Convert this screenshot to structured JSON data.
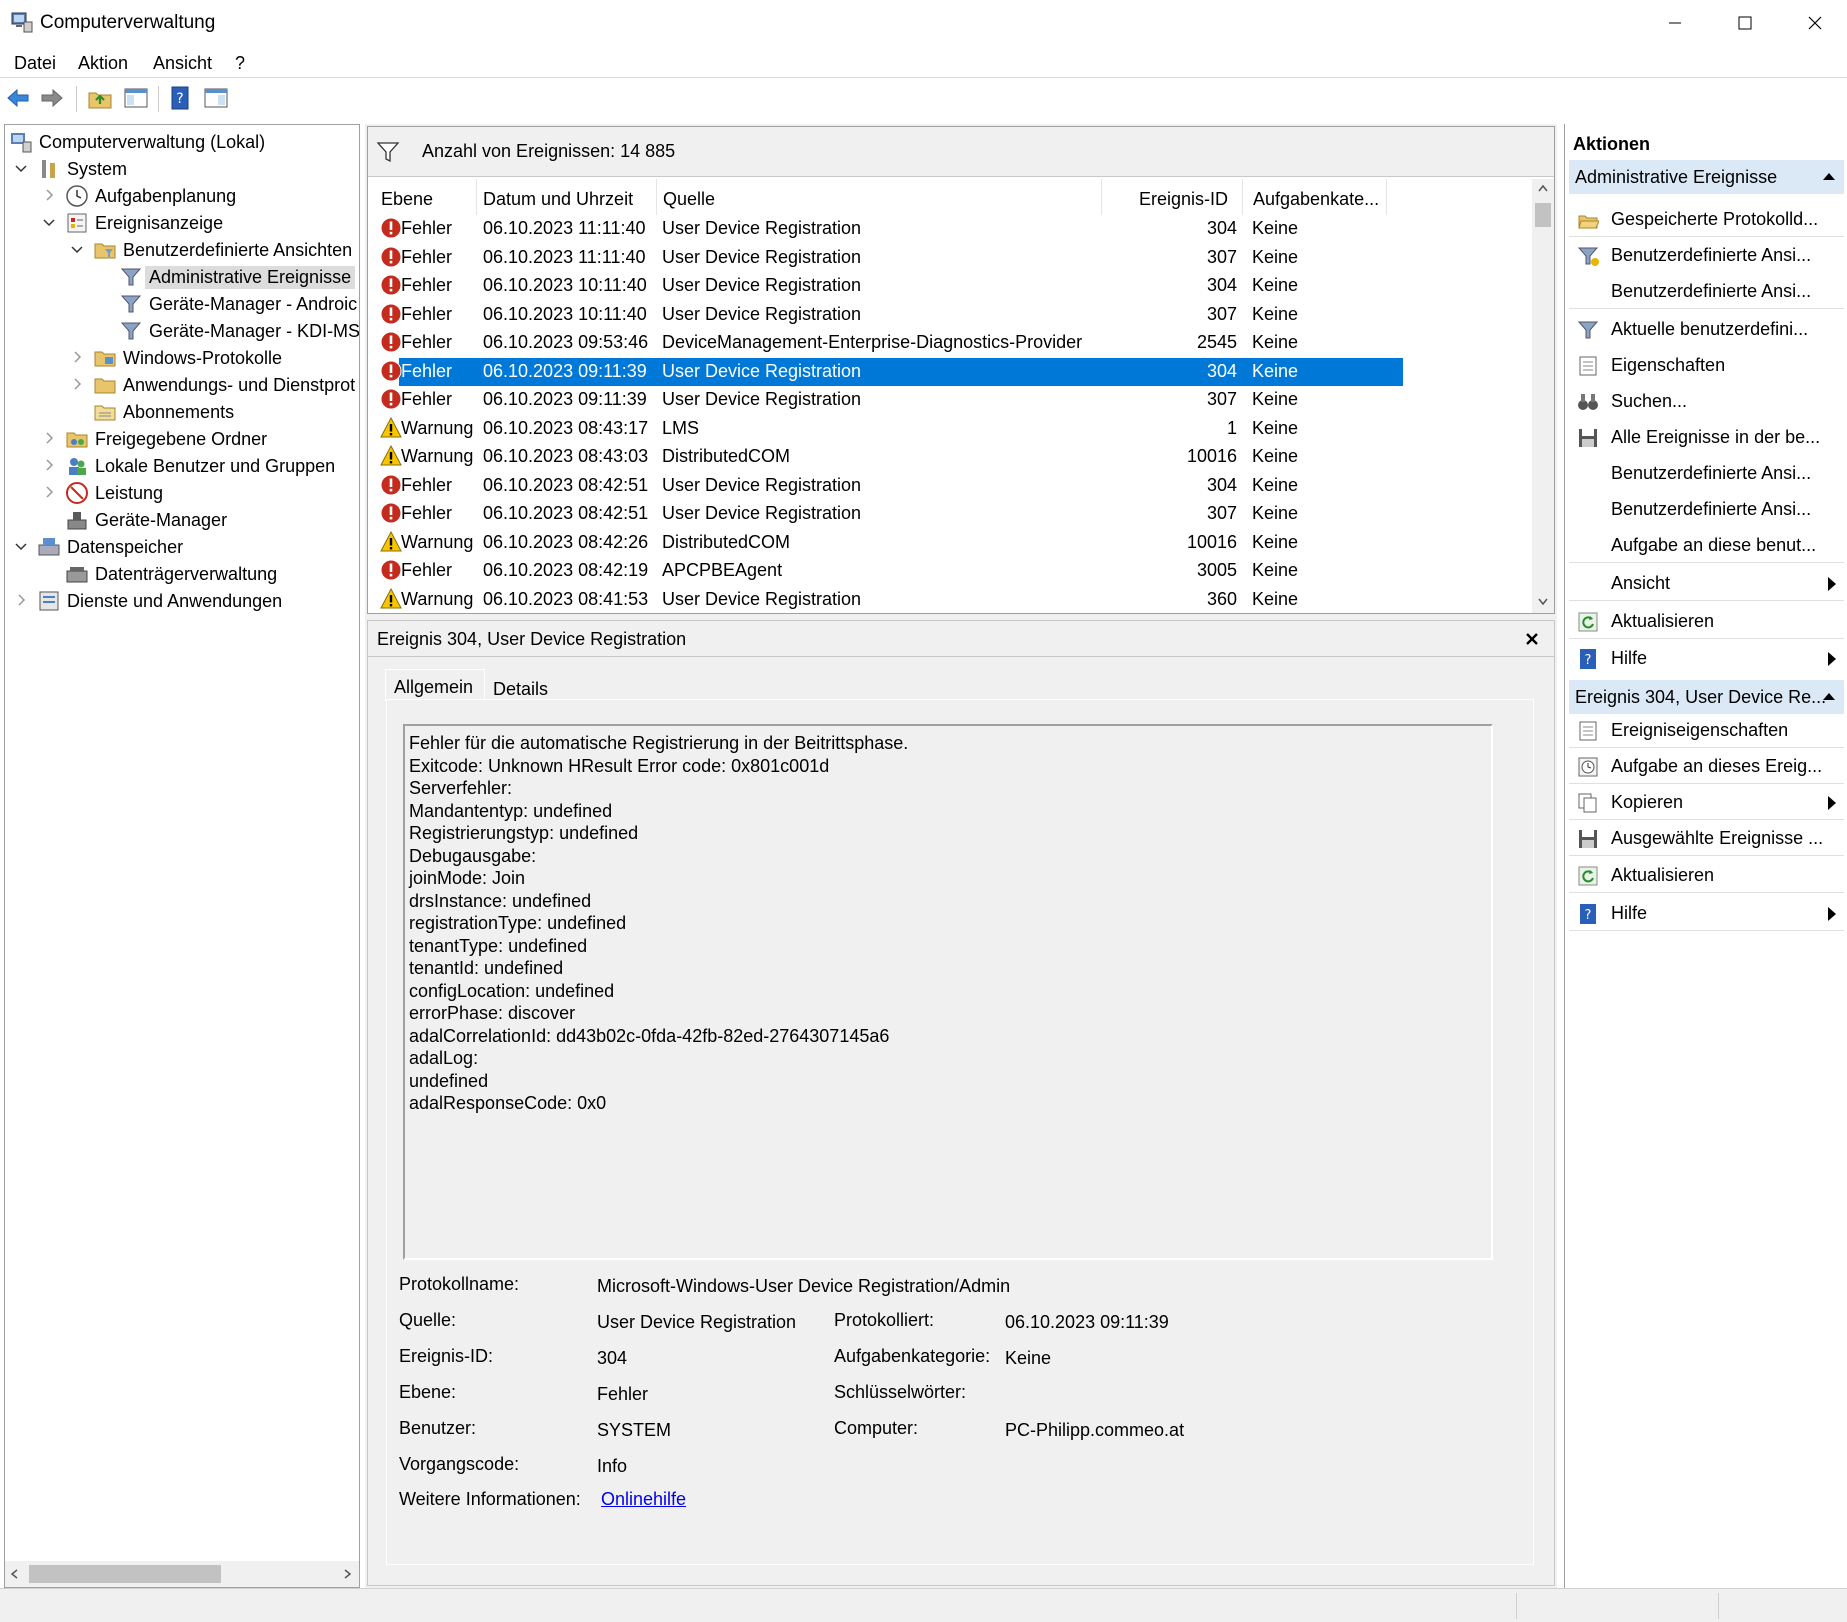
{
  "window": {
    "title": "Computerverwaltung"
  },
  "menu": [
    "Datei",
    "Aktion",
    "Ansicht",
    "?"
  ],
  "tree": {
    "root": "Computerverwaltung (Lokal)",
    "system": "System",
    "aufgabenplanung": "Aufgabenplanung",
    "ereignisanzeige": "Ereignisanzeige",
    "benutzerdefinierte": "Benutzerdefinierte Ansichten",
    "admin_ereignisse": "Administrative Ereignisse",
    "geraete_android": "Geräte-Manager - Androic",
    "geraete_kdi": "Geräte-Manager - KDI-MS",
    "windows_protokolle": "Windows-Protokolle",
    "anwendungs_protokolle": "Anwendungs- und Dienstprot",
    "abonnements": "Abonnements",
    "freigegebene": "Freigegebene Ordner",
    "lokale_benutzer": "Lokale Benutzer und Gruppen",
    "leistung": "Leistung",
    "geraete_manager": "Geräte-Manager",
    "datenspeicher": "Datenspeicher",
    "datentraeger": "Datenträgerverwaltung",
    "dienste": "Dienste und Anwendungen"
  },
  "events": {
    "count_label": "Anzahl von Ereignissen: 14 885",
    "columns": [
      "Ebene",
      "Datum und Uhrzeit",
      "Quelle",
      "Ereignis-ID",
      "Aufgabenkate..."
    ],
    "rows": [
      {
        "level": "Fehler",
        "date": "06.10.2023 11:11:40",
        "source": "User Device Registration",
        "id": "304",
        "task": "Keine",
        "type": "error"
      },
      {
        "level": "Fehler",
        "date": "06.10.2023 11:11:40",
        "source": "User Device Registration",
        "id": "307",
        "task": "Keine",
        "type": "error"
      },
      {
        "level": "Fehler",
        "date": "06.10.2023 10:11:40",
        "source": "User Device Registration",
        "id": "304",
        "task": "Keine",
        "type": "error"
      },
      {
        "level": "Fehler",
        "date": "06.10.2023 10:11:40",
        "source": "User Device Registration",
        "id": "307",
        "task": "Keine",
        "type": "error"
      },
      {
        "level": "Fehler",
        "date": "06.10.2023 09:53:46",
        "source": "DeviceManagement-Enterprise-Diagnostics-Provider",
        "id": "2545",
        "task": "Keine",
        "type": "error"
      },
      {
        "level": "Fehler",
        "date": "06.10.2023 09:11:39",
        "source": "User Device Registration",
        "id": "304",
        "task": "Keine",
        "type": "error",
        "selected": true
      },
      {
        "level": "Fehler",
        "date": "06.10.2023 09:11:39",
        "source": "User Device Registration",
        "id": "307",
        "task": "Keine",
        "type": "error"
      },
      {
        "level": "Warnung",
        "date": "06.10.2023 08:43:17",
        "source": "LMS",
        "id": "1",
        "task": "Keine",
        "type": "warning"
      },
      {
        "level": "Warnung",
        "date": "06.10.2023 08:43:03",
        "source": "DistributedCOM",
        "id": "10016",
        "task": "Keine",
        "type": "warning"
      },
      {
        "level": "Fehler",
        "date": "06.10.2023 08:42:51",
        "source": "User Device Registration",
        "id": "304",
        "task": "Keine",
        "type": "error"
      },
      {
        "level": "Fehler",
        "date": "06.10.2023 08:42:51",
        "source": "User Device Registration",
        "id": "307",
        "task": "Keine",
        "type": "error"
      },
      {
        "level": "Warnung",
        "date": "06.10.2023 08:42:26",
        "source": "DistributedCOM",
        "id": "10016",
        "task": "Keine",
        "type": "warning"
      },
      {
        "level": "Fehler",
        "date": "06.10.2023 08:42:19",
        "source": "APCPBEAgent",
        "id": "3005",
        "task": "Keine",
        "type": "error"
      },
      {
        "level": "Warnung",
        "date": "06.10.2023 08:41:53",
        "source": "User Device Registration",
        "id": "360",
        "task": "Keine",
        "type": "warning"
      }
    ]
  },
  "detail": {
    "title": "Ereignis 304, User Device Registration",
    "tabs": [
      "Allgemein",
      "Details"
    ],
    "message": [
      "Fehler für die automatische Registrierung in der Beitrittsphase.",
      "Exitcode: Unknown HResult Error code: 0x801c001d",
      "Serverfehler:",
      "Mandantentyp: undefined",
      "Registrierungstyp: undefined",
      "Debugausgabe:",
      "joinMode: Join",
      "drsInstance: undefined",
      "registrationType: undefined",
      "tenantType: undefined",
      "tenantId: undefined",
      "configLocation: undefined",
      "errorPhase: discover",
      "adalCorrelationId: dd43b02c-0fda-42fb-82ed-2764307145a6",
      "adalLog:",
      "undefined",
      "adalResponseCode: 0x0"
    ],
    "labels": {
      "protokollname": "Protokollname:",
      "quelle": "Quelle:",
      "ereignis_id": "Ereignis-ID:",
      "ebene": "Ebene:",
      "benutzer": "Benutzer:",
      "vorgangscode": "Vorgangscode:",
      "weitere": "Weitere Informationen:",
      "protokolliert": "Protokolliert:",
      "aufgabenkategorie": "Aufgabenkategorie:",
      "schluesselwoerter": "Schlüsselwörter:",
      "computer": "Computer:"
    },
    "values": {
      "protokollname": "Microsoft-Windows-User Device Registration/Admin",
      "quelle": "User Device Registration",
      "ereignis_id": "304",
      "ebene": "Fehler",
      "benutzer": "SYSTEM",
      "vorgangscode": "Info",
      "weitere": "Onlinehilfe",
      "protokolliert": "06.10.2023 09:11:39",
      "aufgabenkategorie": "Keine",
      "schluesselwoerter": "",
      "computer": "PC-Philipp.commeo.at"
    }
  },
  "actions": {
    "title": "Aktionen",
    "section1": "Administrative Ereignisse",
    "items1": [
      "Gespeicherte Protokolld...",
      "Benutzerdefinierte Ansi...",
      "Benutzerdefinierte Ansi...",
      "Aktuelle benutzerdefini...",
      "Eigenschaften",
      "Suchen...",
      "Alle Ereignisse in der be...",
      "Benutzerdefinierte Ansi...",
      "Benutzerdefinierte Ansi...",
      "Aufgabe an diese benut...",
      "Ansicht",
      "Aktualisieren",
      "Hilfe"
    ],
    "section2": "Ereignis 304, User Device Re...",
    "items2": [
      "Ereigniseigenschaften",
      "Aufgabe an dieses Ereig...",
      "Kopieren",
      "Ausgewählte Ereignisse ...",
      "Aktualisieren",
      "Hilfe"
    ]
  },
  "colors": {
    "selection": "#0078d7",
    "error": "#c42b1c",
    "warning": "#f7c600",
    "action_header": "#dbe8f5",
    "link": "#0000ee"
  }
}
